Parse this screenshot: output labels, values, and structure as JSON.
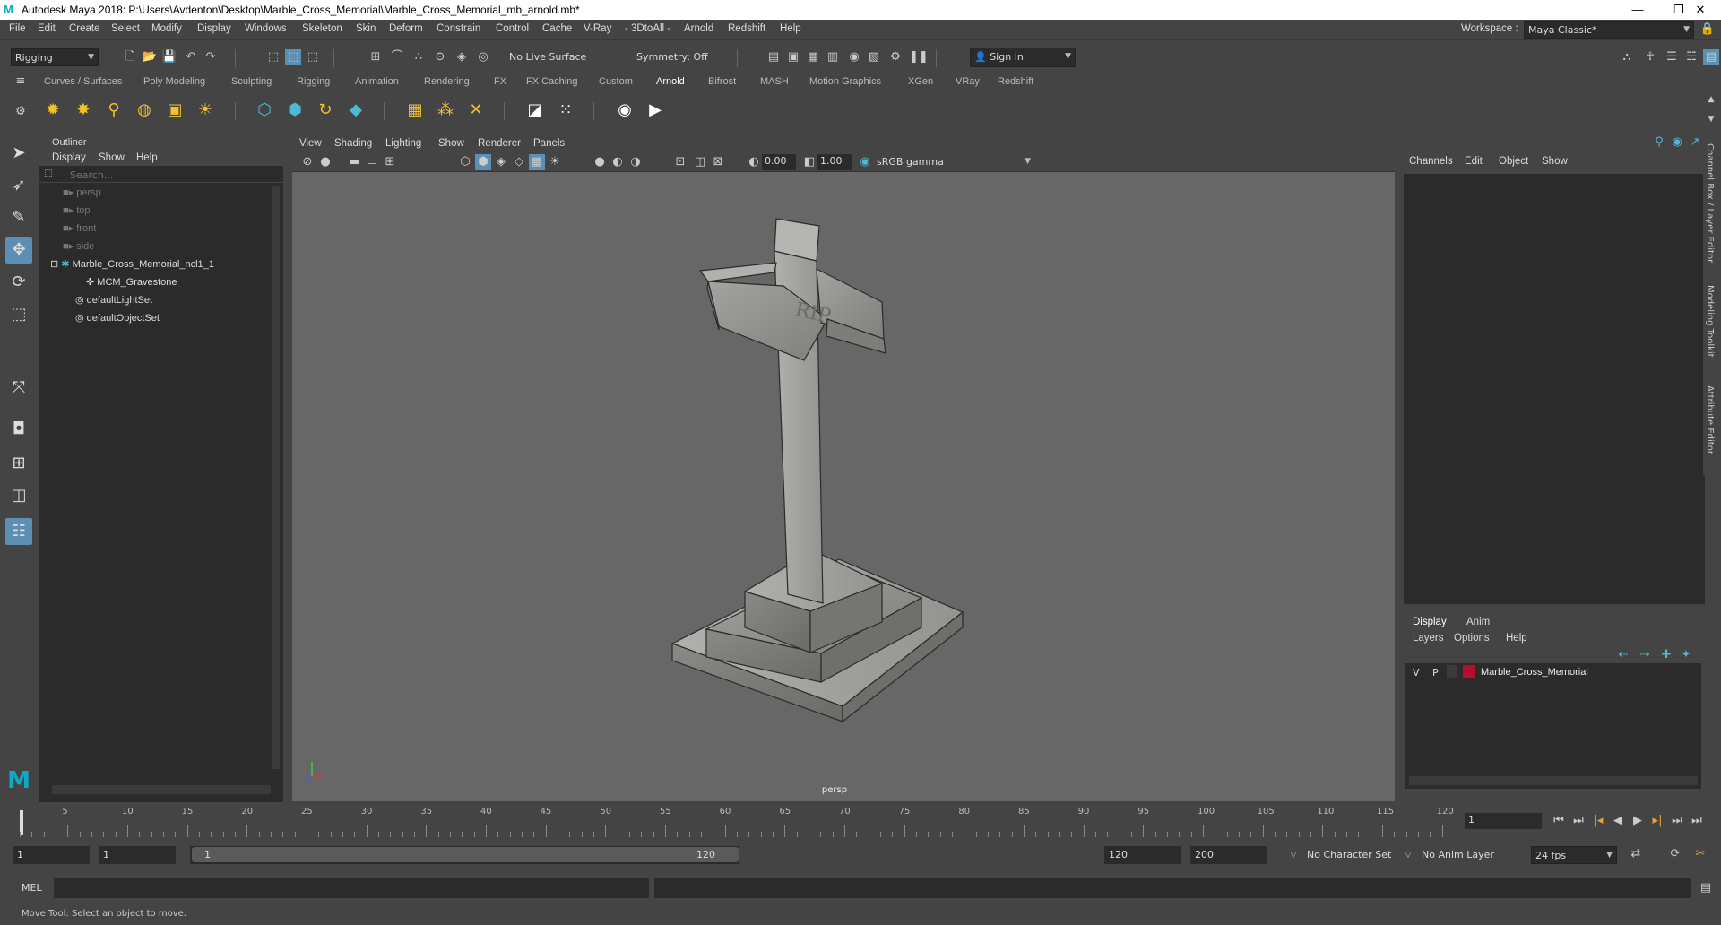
{
  "window": {
    "title": "Autodesk Maya 2018: P:\\Users\\Avdenton\\Desktop\\Marble_Cross_Memorial\\Marble_Cross_Memorial_mb_arnold.mb*",
    "minimize": "—",
    "maximize": "❐",
    "close": "✕"
  },
  "menubar": [
    "File",
    "Edit",
    "Create",
    "Select",
    "Modify",
    "Display",
    "Windows",
    "Skeleton",
    "Skin",
    "Deform",
    "Constrain",
    "Control",
    "Cache",
    "V-Ray",
    "- 3DtoAll -",
    "Arnold",
    "Redshift",
    "Help"
  ],
  "workspace": {
    "label": "Workspace :",
    "value": "Maya Classic*"
  },
  "status": {
    "mode": "Rigging",
    "live_surface": "No Live Surface",
    "symmetry": "Symmetry: Off",
    "sign_in": "Sign In"
  },
  "shelf_tabs": [
    "Curves / Surfaces",
    "Poly Modeling",
    "Sculpting",
    "Rigging",
    "Animation",
    "Rendering",
    "FX",
    "FX Caching",
    "Custom",
    "Arnold",
    "Bifrost",
    "MASH",
    "Motion Graphics",
    "XGen",
    "VRay",
    "Redshift"
  ],
  "shelf_active": "Arnold",
  "outliner": {
    "title": "Outliner",
    "menu": [
      "Display",
      "Show",
      "Help"
    ],
    "search_placeholder": "Search...",
    "items": [
      {
        "label": "persp",
        "dim": true
      },
      {
        "label": "top",
        "dim": true
      },
      {
        "label": "front",
        "dim": true
      },
      {
        "label": "side",
        "dim": true
      },
      {
        "label": "Marble_Cross_Memorial_ncl1_1",
        "dim": false
      },
      {
        "label": "MCM_Gravestone",
        "dim": false
      },
      {
        "label": "defaultLightSet",
        "dim": false
      },
      {
        "label": "defaultObjectSet",
        "dim": false
      }
    ]
  },
  "viewport": {
    "menu": [
      "View",
      "Shading",
      "Lighting",
      "Show",
      "Renderer",
      "Panels"
    ],
    "exposure": "0.00",
    "gamma": "1.00",
    "color_space": "sRGB gamma",
    "camera_label": "persp",
    "engraving": "RIP"
  },
  "channel_box": {
    "menu": [
      "Channels",
      "Edit",
      "Object",
      "Show"
    ]
  },
  "layer_editor": {
    "tabs": [
      "Display",
      "Anim"
    ],
    "menu": [
      "Layers",
      "Options",
      "Help"
    ],
    "layer": {
      "v": "V",
      "p": "P",
      "name": "Marble_Cross_Memorial",
      "color": "#b5102a"
    }
  },
  "side_tabs": [
    "Channel Box / Layer Editor",
    "Modeling Toolkit",
    "Attribute Editor"
  ],
  "timeline": {
    "ticks": [
      5,
      10,
      15,
      20,
      25,
      30,
      35,
      40,
      45,
      50,
      55,
      60,
      65,
      70,
      75,
      80,
      85,
      90,
      95,
      100,
      105,
      110,
      115,
      120
    ],
    "current_frame": "1",
    "start": "1",
    "range_start": "1",
    "range_inner_start": "1",
    "range_inner_end": "120",
    "range_end": "120",
    "anim_end": "200",
    "character_set": "No Character Set",
    "anim_layer": "No Anim Layer",
    "fps": "24 fps"
  },
  "cmdline": {
    "label": "MEL"
  },
  "helpline": "Move Tool: Select an object to move."
}
